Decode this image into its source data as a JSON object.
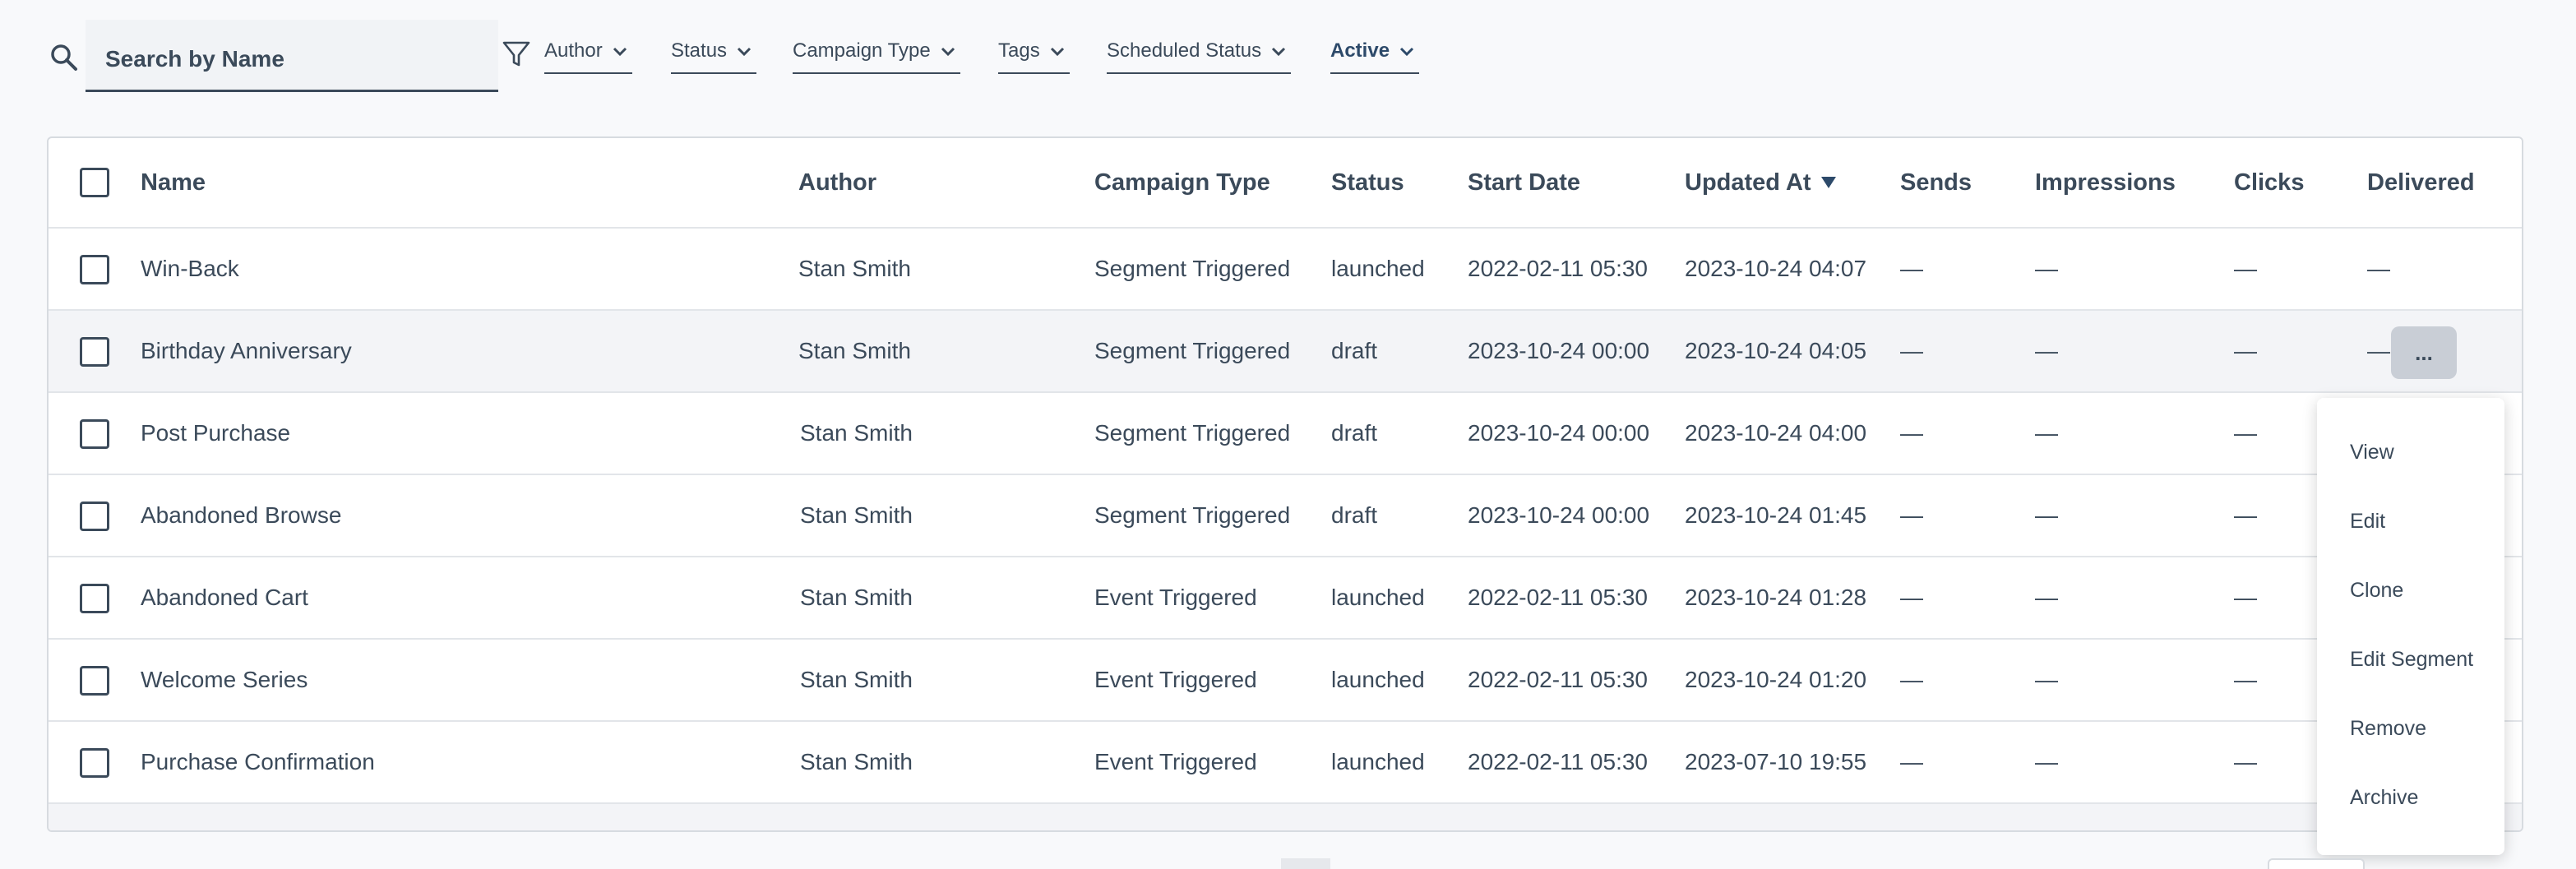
{
  "search": {
    "placeholder": "Search by Name"
  },
  "filters": [
    {
      "label": "Author"
    },
    {
      "label": "Status"
    },
    {
      "label": "Campaign Type"
    },
    {
      "label": "Tags"
    },
    {
      "label": "Scheduled Status"
    },
    {
      "label": "Active"
    }
  ],
  "table": {
    "columns": [
      "Name",
      "Author",
      "Campaign Type",
      "Status",
      "Start Date",
      "Updated At",
      "Sends",
      "Impressions",
      "Clicks",
      "Delivered"
    ],
    "rows": [
      {
        "name": "Win-Back",
        "author": "Stan Smith",
        "type": "Segment Triggered",
        "status": "launched",
        "start": "2022-02-11 05:30",
        "updated": "2023-10-24 04:07",
        "sends": "—",
        "impressions": "—",
        "clicks": "—",
        "delivered": "—"
      },
      {
        "name": "Birthday Anniversary",
        "author": "Stan Smith",
        "type": "Segment Triggered",
        "status": "draft",
        "start": "2023-10-24 00:00",
        "updated": "2023-10-24 04:05",
        "sends": "—",
        "impressions": "—",
        "clicks": "—",
        "delivered": "—"
      },
      {
        "name": "Post Purchase",
        "author": "Stan Smith",
        "type": "Segment Triggered",
        "status": "draft",
        "start": "2023-10-24 00:00",
        "updated": "2023-10-24 04:00",
        "sends": "—",
        "impressions": "—",
        "clicks": "—",
        "delivered": ""
      },
      {
        "name": "Abandoned Browse",
        "author": "Stan Smith",
        "type": "Segment Triggered",
        "status": "draft",
        "start": "2023-10-24 00:00",
        "updated": "2023-10-24 01:45",
        "sends": "—",
        "impressions": "—",
        "clicks": "—",
        "delivered": ""
      },
      {
        "name": "Abandoned Cart",
        "author": "Stan Smith",
        "type": "Event Triggered",
        "status": "launched",
        "start": "2022-02-11 05:30",
        "updated": "2023-10-24 01:28",
        "sends": "—",
        "impressions": "—",
        "clicks": "—",
        "delivered": ""
      },
      {
        "name": "Welcome Series",
        "author": "Stan Smith",
        "type": "Event Triggered",
        "status": "launched",
        "start": "2022-02-11 05:30",
        "updated": "2023-10-24 01:20",
        "sends": "—",
        "impressions": "—",
        "clicks": "—",
        "delivered": ""
      },
      {
        "name": "Purchase Confirmation",
        "author": "Stan Smith",
        "type": "Event Triggered",
        "status": "launched",
        "start": "2022-02-11 05:30",
        "updated": "2023-07-10 19:55",
        "sends": "—",
        "impressions": "—",
        "clicks": "—",
        "delivered": ""
      }
    ],
    "sorted_column": "Updated At",
    "sort_direction": "descending"
  },
  "row_actions": {
    "button_label": "...",
    "menu": [
      "View",
      "Edit",
      "Clone",
      "Edit Segment",
      "Remove",
      "Archive"
    ]
  }
}
